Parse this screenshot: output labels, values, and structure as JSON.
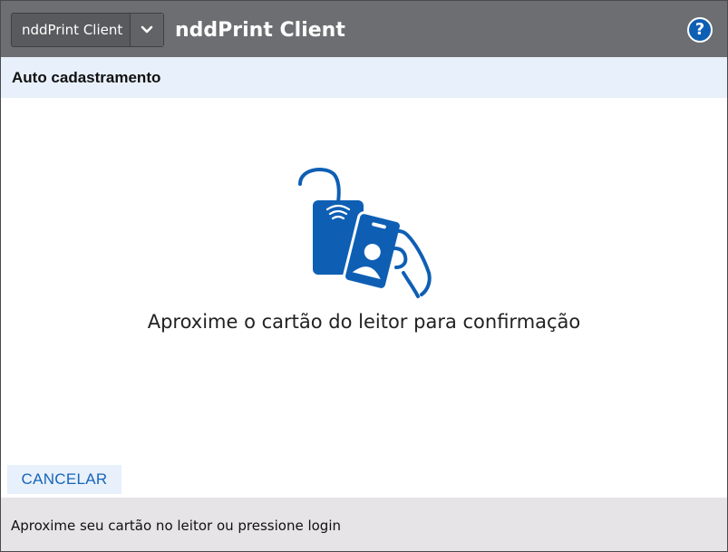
{
  "header": {
    "app_selector_value": "nddPrint Client",
    "title": "nddPrint Client",
    "help_label": "?",
    "background_color": "#6d6e71"
  },
  "section": {
    "title": "Auto cadastramento",
    "background_color": "#e8f0fb"
  },
  "main": {
    "illustration_icon": "card-reader-icon",
    "instruction": "Aproxime o cartão do leitor para confirmação",
    "accent_color": "#0e5fb4"
  },
  "actions": {
    "cancel_label": "CANCELAR"
  },
  "status_bar": {
    "text": "Aproxime seu cartão no leitor ou pressione login",
    "background_color": "#e6e4e6"
  }
}
